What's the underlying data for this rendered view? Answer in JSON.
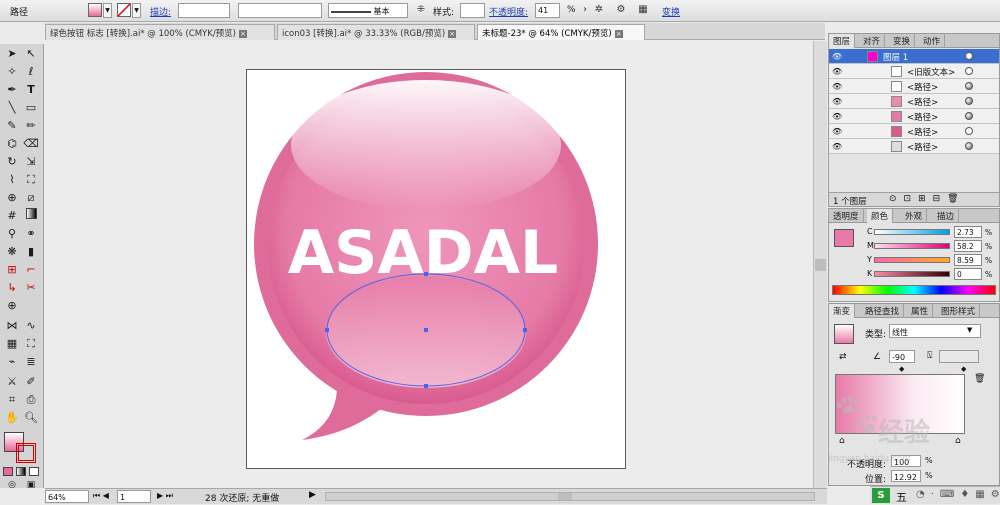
{
  "control_bar": {
    "object_type": "路径",
    "stroke_label": "描边:",
    "stroke_weight": "",
    "profile_label": "基本",
    "style_label": "样式:",
    "opacity_label": "不透明度:",
    "opacity_value": "41",
    "opacity_unit": "%",
    "transform_label": "变换"
  },
  "tabs": [
    {
      "label": "绿色按钮 标志 [转换].ai* @ 100% (CMYK/预览)",
      "active": false
    },
    {
      "label": "icon03 [转换].ai* @ 33.33% (RGB/预览)",
      "active": false
    },
    {
      "label": "未标题-23* @ 64% (CMYK/预览)",
      "active": true
    }
  ],
  "artwork": {
    "text": "ASADAL",
    "bubble_color": "#e06a9a",
    "inner_color": "#ec8bb2"
  },
  "status_bar": {
    "zoom": "64%",
    "page": "1",
    "history": "28 次还原; 无重做"
  },
  "layers_panel": {
    "tabs": [
      "图层",
      "对齐",
      "变换",
      "动作"
    ],
    "rows": [
      {
        "name": "图层 1",
        "selected": true
      },
      {
        "name": "<旧版文本>",
        "selected": false
      },
      {
        "name": "<路径>",
        "selected": false
      },
      {
        "name": "<路径>",
        "selected": false
      },
      {
        "name": "<路径>",
        "selected": false
      },
      {
        "name": "<路径>",
        "selected": false
      },
      {
        "name": "<路径>",
        "selected": false
      }
    ],
    "footer": "1 个图层"
  },
  "color_panel": {
    "tabs": [
      "透明度",
      "颜色",
      "外观",
      "描边"
    ],
    "channels": [
      {
        "name": "C",
        "value": "2.73"
      },
      {
        "name": "M",
        "value": "58.2"
      },
      {
        "name": "Y",
        "value": "8.59"
      },
      {
        "name": "K",
        "value": "0"
      }
    ],
    "unit": "%"
  },
  "gradient_panel": {
    "tabs": [
      "渐变",
      "路径查找",
      "属性",
      "图形样式"
    ],
    "type_label": "类型:",
    "type_value": "线性",
    "angle": "-90",
    "opacity_label": "不透明度:",
    "opacity_value": "100",
    "location_label": "位置:",
    "location_value": "12.92",
    "unit": "%"
  },
  "watermark": {
    "text_cn": "经验",
    "text_url": "jingyan.baidu.com"
  },
  "taskbar": {
    "ime": "五"
  }
}
